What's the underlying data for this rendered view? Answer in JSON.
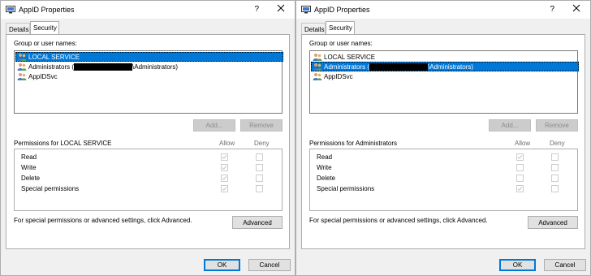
{
  "dialogs": [
    {
      "title": "AppID Properties",
      "help": "?",
      "tabs": [
        "Details",
        "Security"
      ],
      "group_label": "Group or user names:",
      "users": [
        {
          "prefix": "LOCAL SERVICE",
          "suffix": "",
          "redacted": false,
          "selected": true
        },
        {
          "prefix": "Administrators (",
          "suffix": "\\Administrators)",
          "redacted": true,
          "selected": false
        },
        {
          "prefix": "AppIDSvc",
          "suffix": "",
          "redacted": false,
          "selected": false
        }
      ],
      "add_label": "Add...",
      "remove_label": "Remove",
      "permissions_label": "Permissions for LOCAL SERVICE",
      "allow_label": "Allow",
      "deny_label": "Deny",
      "permissions": [
        {
          "name": "Read",
          "allow": true,
          "deny": false
        },
        {
          "name": "Write",
          "allow": true,
          "deny": false
        },
        {
          "name": "Delete",
          "allow": true,
          "deny": false
        },
        {
          "name": "Special permissions",
          "allow": true,
          "deny": false
        }
      ],
      "advanced_text": "For special permissions or advanced settings, click Advanced.",
      "advanced_label": "Advanced",
      "ok_label": "OK",
      "cancel_label": "Cancel"
    },
    {
      "title": "AppID Properties",
      "help": "?",
      "tabs": [
        "Details",
        "Security"
      ],
      "group_label": "Group or user names:",
      "users": [
        {
          "prefix": "LOCAL SERVICE",
          "suffix": "",
          "redacted": false,
          "selected": false
        },
        {
          "prefix": "Administrators (",
          "suffix": "\\Administrators)",
          "redacted": true,
          "selected": true
        },
        {
          "prefix": "AppIDSvc",
          "suffix": "",
          "redacted": false,
          "selected": false
        }
      ],
      "add_label": "Add...",
      "remove_label": "Remove",
      "permissions_label": "Permissions for Administrators",
      "allow_label": "Allow",
      "deny_label": "Deny",
      "permissions": [
        {
          "name": "Read",
          "allow": true,
          "deny": false
        },
        {
          "name": "Write",
          "allow": false,
          "deny": false
        },
        {
          "name": "Delete",
          "allow": false,
          "deny": false
        },
        {
          "name": "Special permissions",
          "allow": true,
          "deny": false
        }
      ],
      "advanced_text": "For special permissions or advanced settings, click Advanced.",
      "advanced_label": "Advanced",
      "ok_label": "OK",
      "cancel_label": "Cancel"
    }
  ]
}
